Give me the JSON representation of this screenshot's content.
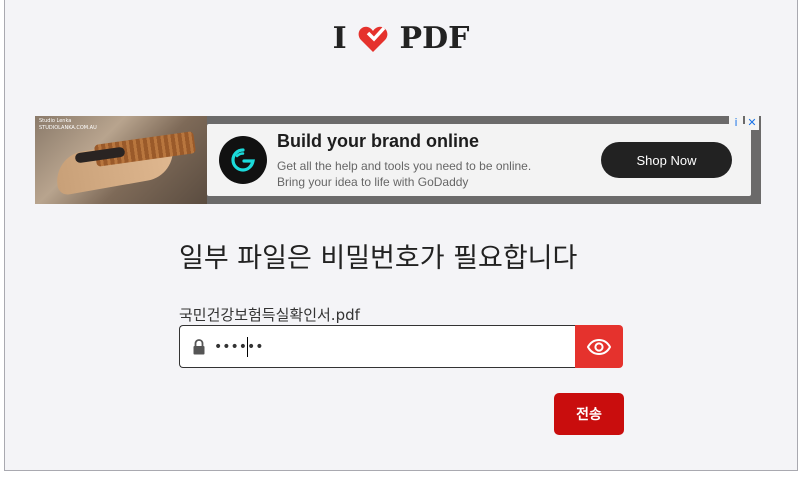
{
  "logo": {
    "left": "I",
    "right": "PDF"
  },
  "ad": {
    "photo_caption_line1": "Studio Lenka",
    "photo_caption_line2": "STUDIOLANKA.COM.AU",
    "title": "Build your brand online",
    "desc_line1": "Get all the help and tools you need to be online.",
    "desc_line2": "Bring your idea to life with GoDaddy",
    "cta": "Shop Now",
    "info_badge": "i",
    "close_badge": "✕"
  },
  "form": {
    "heading": "일부 파일은 비밀번호가 필요합니다",
    "filename": "국민건강보험득실확인서.pdf",
    "password_value": "••••••",
    "submit_label": "전송"
  },
  "colors": {
    "brand_red": "#e5322d",
    "submit_red": "#c90d0d",
    "background": "#f4f4f7"
  }
}
